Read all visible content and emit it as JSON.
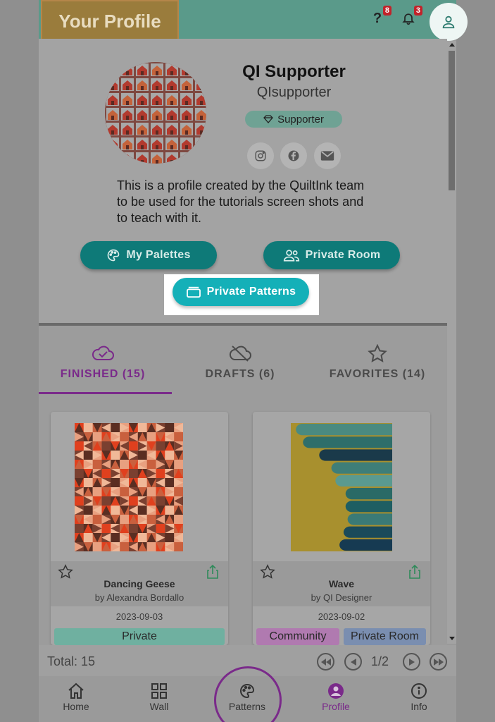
{
  "header": {
    "title": "Your Profile",
    "help_badge": "8",
    "notifications_badge": "3",
    "icons": {
      "help": "help-question-icon",
      "notifications": "bell-icon",
      "account": "user-icon"
    }
  },
  "profile": {
    "display_name": "QI Supporter",
    "username": "QIsupporter",
    "badge_label": "Supporter",
    "bio": "This is a profile created by the QuiltInk team to be used for the tutorials screen shots and to teach with it.",
    "social_icons": [
      "instagram-icon",
      "facebook-icon",
      "email-icon"
    ]
  },
  "actions": {
    "palettes": "My Palettes",
    "private_room": "Private Room",
    "private_patterns": "Private Patterns"
  },
  "tabs": [
    {
      "label": "FINISHED (15)",
      "icon": "cloud-check-icon",
      "active": true
    },
    {
      "label": "DRAFTS (6)",
      "icon": "cloud-off-icon",
      "active": false
    },
    {
      "label": "FAVORITES (14)",
      "icon": "star-icon",
      "active": false
    }
  ],
  "patterns": [
    {
      "title": "Dancing Geese",
      "author": "by Alexandra Bordallo",
      "date": "2023-09-03",
      "tags": [
        "Private"
      ]
    },
    {
      "title": "Wave",
      "author": "by QI Designer",
      "date": "2023-09-02",
      "tags": [
        "Community",
        "Private Room"
      ]
    }
  ],
  "pagination": {
    "total": "Total: 15",
    "page": "1/2"
  },
  "nav": {
    "home": "Home",
    "wall": "Wall",
    "patterns": "Patterns",
    "profile": "Profile",
    "info": "Info"
  },
  "colors": {
    "header_teal": "#5a9a8a",
    "button_teal": "#0e7a78",
    "highlight_button": "#14b0b8",
    "active_purple": "#7a2a8a",
    "private_tag": "#6fb0a0",
    "community_tag": "#b07ab0",
    "private_room_tag": "#7a8eb0"
  }
}
